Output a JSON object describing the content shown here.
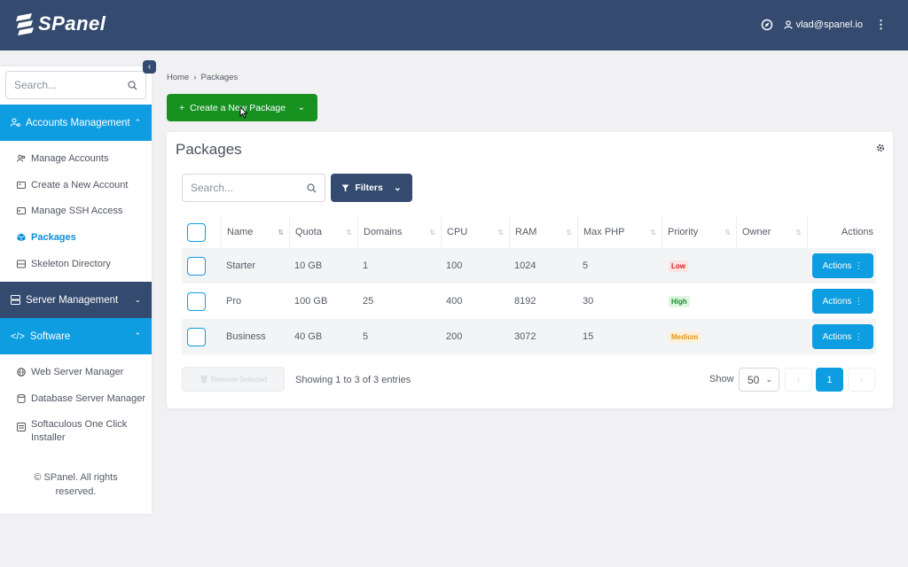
{
  "app": {
    "logo_text": "SPanel"
  },
  "header": {
    "user_email": "vlad@spanel.io"
  },
  "sidebar": {
    "search_placeholder": "Search...",
    "sections": [
      {
        "label": "Accounts Management",
        "expanded": true
      },
      {
        "label": "Server Management",
        "expanded": false
      },
      {
        "label": "Software",
        "expanded": true
      }
    ],
    "accounts_items": [
      "Manage Accounts",
      "Create a New Account",
      "Manage SSH Access",
      "Packages",
      "Skeleton Directory"
    ],
    "software_items": [
      "Web Server Manager",
      "Database Server Manager",
      "Softaculous One Click",
      "Installer"
    ],
    "footer_line1": "© SPanel. All rights",
    "footer_line2": "reserved."
  },
  "breadcrumb": {
    "home": "Home",
    "separator": "›",
    "current": "Packages"
  },
  "create_button": {
    "label": "Create a New Package"
  },
  "panel": {
    "title": "Packages",
    "search_placeholder": "Search...",
    "filters_label": "Filters",
    "columns": [
      "Name",
      "Quota",
      "Domains",
      "CPU",
      "RAM",
      "Max PHP",
      "Priority",
      "Owner",
      "Actions"
    ],
    "rows": [
      {
        "name": "Starter",
        "quota": "10 GB",
        "domains": "1",
        "cpu": "100",
        "ram": "1024",
        "max_php": "5",
        "priority": "Low",
        "owner": "",
        "action": "Actions"
      },
      {
        "name": "Pro",
        "quota": "100 GB",
        "domains": "25",
        "cpu": "400",
        "ram": "8192",
        "max_php": "30",
        "priority": "High",
        "owner": "",
        "action": "Actions"
      },
      {
        "name": "Business",
        "quota": "40 GB",
        "domains": "5",
        "cpu": "200",
        "ram": "3072",
        "max_php": "15",
        "priority": "Medium",
        "owner": "",
        "action": "Actions"
      }
    ],
    "remove_label": "Remove Selected",
    "showing_text": "Showing 1 to 3 of 3 entries",
    "show_label": "Show",
    "page_size": "50",
    "current_page": "1"
  },
  "colors": {
    "navy": "#344a6e",
    "blue": "#0d9de0",
    "green": "#179221"
  }
}
